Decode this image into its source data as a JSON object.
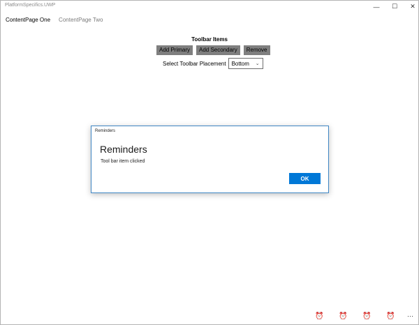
{
  "window": {
    "title": "PlatformSpecifics.UWP",
    "controls": {
      "minimize": "—",
      "maximize": "☐",
      "close": "✕"
    }
  },
  "tabs": [
    {
      "label": "ContentPage One",
      "active": true
    },
    {
      "label": "ContentPage Two",
      "active": false
    }
  ],
  "main": {
    "section_title": "Toolbar Items",
    "buttons": {
      "add_primary": "Add Primary",
      "add_secondary": "Add Secondary",
      "remove": "Remove"
    },
    "placement_label": "Select Toolbar Placement",
    "placement_value": "Bottom"
  },
  "dialog": {
    "caption": "Reminders",
    "heading": "Reminders",
    "message": "Tool bar item clicked",
    "ok_label": "OK"
  },
  "toolbar": {
    "icons": [
      "alarm-clock-icon",
      "alarm-clock-icon",
      "alarm-clock-icon",
      "alarm-clock-icon"
    ],
    "more_icon": "more-icon"
  },
  "colors": {
    "accent": "#0078d7",
    "button_gray": "#7f7f7f",
    "dialog_border": "#3f86c4"
  }
}
